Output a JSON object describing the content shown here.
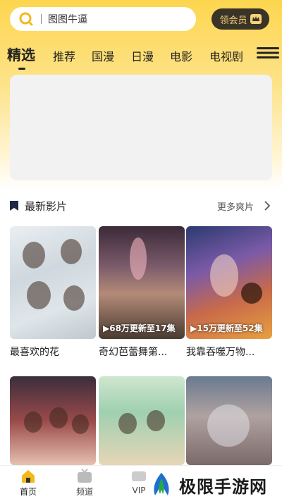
{
  "search": {
    "placeholder": "图图牛逼"
  },
  "vip_button": {
    "label": "领会员"
  },
  "tabs": [
    {
      "label": "精选",
      "active": true
    },
    {
      "label": "推荐"
    },
    {
      "label": "国漫"
    },
    {
      "label": "日漫"
    },
    {
      "label": "电影"
    },
    {
      "label": "电视剧"
    }
  ],
  "section": {
    "title": "最新影片",
    "more": "更多爽片"
  },
  "movies": [
    {
      "title": "最喜欢的花",
      "label": ""
    },
    {
      "title": "奇幻芭蕾舞第...",
      "label": "▶68万更新至17集"
    },
    {
      "title": "我靠吞噬万物...",
      "label": "▶15万更新至52集"
    },
    {
      "title": "",
      "label": ""
    },
    {
      "title": "",
      "label": ""
    },
    {
      "title": "",
      "label": ""
    }
  ],
  "bottom_nav": [
    {
      "label": "首页",
      "active": true
    },
    {
      "label": "频道"
    },
    {
      "label": "VIP"
    }
  ],
  "watermark": {
    "text": "极限手游网"
  },
  "colors": {
    "accent": "#fdd64f",
    "vip_bg": "#3a3328",
    "vip_text": "#f5d27a"
  }
}
